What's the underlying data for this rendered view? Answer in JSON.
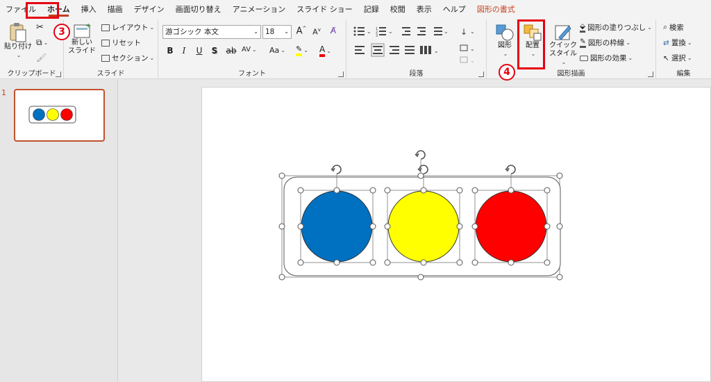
{
  "tabs": [
    {
      "label": "ファイル",
      "active": false
    },
    {
      "label": "ホーム",
      "active": true
    },
    {
      "label": "挿入",
      "active": false
    },
    {
      "label": "描画",
      "active": false
    },
    {
      "label": "デザイン",
      "active": false
    },
    {
      "label": "画面切り替え",
      "active": false
    },
    {
      "label": "アニメーション",
      "active": false
    },
    {
      "label": "スライド ショー",
      "active": false
    },
    {
      "label": "記録",
      "active": false
    },
    {
      "label": "校閲",
      "active": false
    },
    {
      "label": "表示",
      "active": false
    },
    {
      "label": "ヘルプ",
      "active": false
    },
    {
      "label": "図形の書式",
      "active": false,
      "context": true
    }
  ],
  "clipboard": {
    "paste_label": "貼り付け",
    "group_label": "クリップボード"
  },
  "slides_group": {
    "new_slide_label_1": "新しい",
    "new_slide_label_2": "スライド",
    "layout_label": "レイアウト",
    "reset_label": "リセット",
    "section_label": "セクション",
    "group_label": "スライド"
  },
  "font_group": {
    "font_name": "游ゴシック 本文",
    "font_size": "18",
    "grow": "A",
    "shrink": "A",
    "bold": "B",
    "italic": "I",
    "underline": "U",
    "shadow": "S",
    "strike": "ab",
    "spacing": "AV",
    "case": "Aa",
    "highlight": "ab",
    "color": "A",
    "group_label": "フォント"
  },
  "paragraph_group": {
    "group_label": "段落"
  },
  "drawing_group": {
    "shapes_label": "図形",
    "arrange_label": "配置",
    "quick_style_1": "クイック",
    "quick_style_2": "スタイル",
    "fill_label": "図形の塗りつぶし",
    "outline_label": "図形の枠線",
    "effect_label": "図形の効果",
    "group_label": "図形描画"
  },
  "editing_group": {
    "find_label": "検索",
    "replace_label": "置換",
    "select_label": "選択",
    "group_label": "編集"
  },
  "annotations": {
    "step3": "3",
    "step4": "4"
  },
  "slide_panel": {
    "slide_number": "1"
  },
  "colors": {
    "accent": "#c43e1c",
    "annotation_red": "#e60012",
    "circle_blue": "#0070c0",
    "circle_yellow": "#ffff00",
    "circle_red": "#ff0000"
  }
}
